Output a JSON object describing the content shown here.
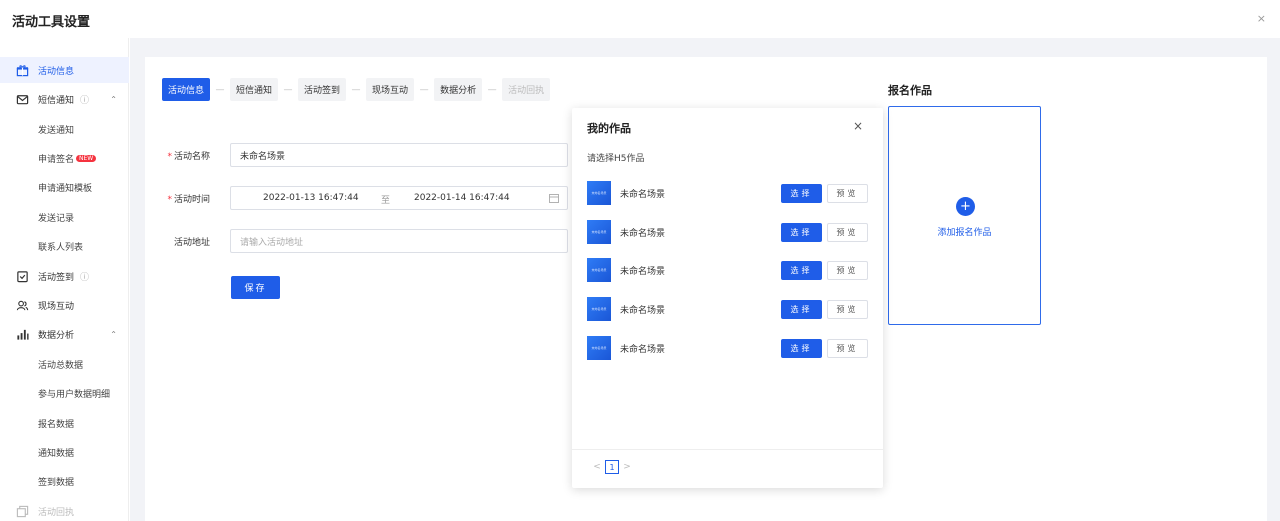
{
  "header": {
    "title": "活动工具设置",
    "close": "×"
  },
  "sidebar": {
    "items": [
      {
        "label": "活动信息",
        "icon": "gift-icon"
      },
      {
        "label": "短信通知",
        "icon": "mail-icon",
        "help": "?",
        "chevron": "⌃"
      },
      {
        "label": "活动签到",
        "icon": "checklist-icon",
        "help": "?"
      },
      {
        "label": "现场互动",
        "icon": "users-icon"
      },
      {
        "label": "数据分析",
        "icon": "bar-chart-icon",
        "chevron": "⌃"
      },
      {
        "label": "活动回执",
        "icon": "copy-icon"
      }
    ],
    "sms_sub": [
      "发送通知",
      "申请签名",
      "申请通知模板",
      "发送记录",
      "联系人列表"
    ],
    "sms_badge": "NEW",
    "data_sub": [
      "活动总数据",
      "参与用户数据明细",
      "报名数据",
      "通知数据",
      "签到数据"
    ]
  },
  "steps": [
    "活动信息",
    "短信通知",
    "活动签到",
    "现场互动",
    "数据分析",
    "活动回执"
  ],
  "step_sep": "—",
  "form": {
    "name_label": "活动名称",
    "name_value": "未命名场景",
    "time_label": "活动时间",
    "time_start": "2022-01-13 16:47:44",
    "time_to": "至",
    "time_end": "2022-01-14 16:47:44",
    "address_label": "活动地址",
    "address_placeholder": "请输入活动地址",
    "required_mark": "*",
    "save": "保存"
  },
  "modal": {
    "title": "我的作品",
    "close": "×",
    "subtitle": "请选择H5作品",
    "works": [
      {
        "name": "未命名场景"
      },
      {
        "name": "未命名场景"
      },
      {
        "name": "未命名场景"
      },
      {
        "name": "未命名场景"
      },
      {
        "name": "未命名场景"
      }
    ],
    "select_label": "选择",
    "preview_label": "预览",
    "pager": {
      "prev": "<",
      "page": "1",
      "next": ">"
    }
  },
  "registration": {
    "title": "报名作品",
    "add_label": "添加报名作品",
    "plus": "+"
  },
  "colors": {
    "primary": "#1f5de8",
    "bg": "#f2f3f7",
    "required": "#f5333f"
  }
}
